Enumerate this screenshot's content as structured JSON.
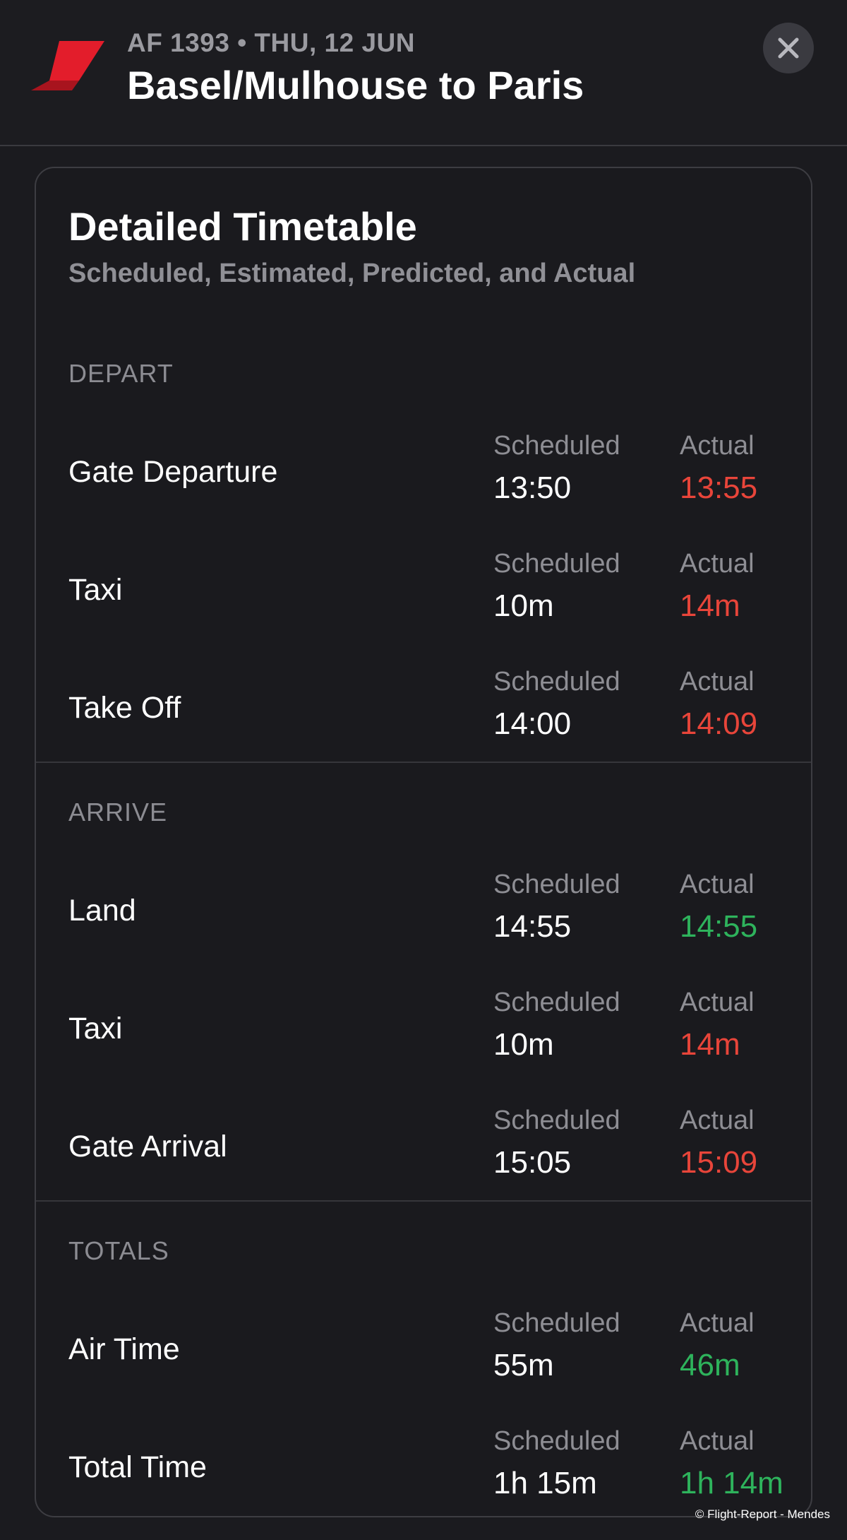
{
  "header": {
    "flight_meta": "AF 1393 • THU, 12 JUN",
    "route_title": "Basel/Mulhouse to Paris",
    "logo_icon": "airline-logo-icon",
    "close_icon": "close-icon",
    "brand_color": "#e31d2b"
  },
  "card": {
    "title": "Detailed Timetable",
    "subtitle": "Scheduled, Estimated, Predicted, and Actual"
  },
  "columns": {
    "scheduled": "Scheduled",
    "actual": "Actual"
  },
  "colors": {
    "late": "#e8453a",
    "on_time": "#2eb35c"
  },
  "sections": {
    "depart": {
      "header": "DEPART",
      "rows": [
        {
          "label": "Gate Departure",
          "scheduled": "13:50",
          "actual": "13:55",
          "status": "late"
        },
        {
          "label": "Taxi",
          "scheduled": "10m",
          "actual": "14m",
          "status": "late"
        },
        {
          "label": "Take Off",
          "scheduled": "14:00",
          "actual": "14:09",
          "status": "late"
        }
      ]
    },
    "arrive": {
      "header": "ARRIVE",
      "rows": [
        {
          "label": "Land",
          "scheduled": "14:55",
          "actual": "14:55",
          "status": "on_time"
        },
        {
          "label": "Taxi",
          "scheduled": "10m",
          "actual": "14m",
          "status": "late"
        },
        {
          "label": "Gate Arrival",
          "scheduled": "15:05",
          "actual": "15:09",
          "status": "late"
        }
      ]
    },
    "totals": {
      "header": "TOTALS",
      "rows": [
        {
          "label": "Air Time",
          "scheduled": "55m",
          "actual": "46m",
          "status": "on_time"
        },
        {
          "label": "Total Time",
          "scheduled": "1h 15m",
          "actual": "1h 14m",
          "status": "on_time"
        }
      ]
    }
  },
  "footer": {
    "copyright": "© Flight-Report - Mendes"
  }
}
